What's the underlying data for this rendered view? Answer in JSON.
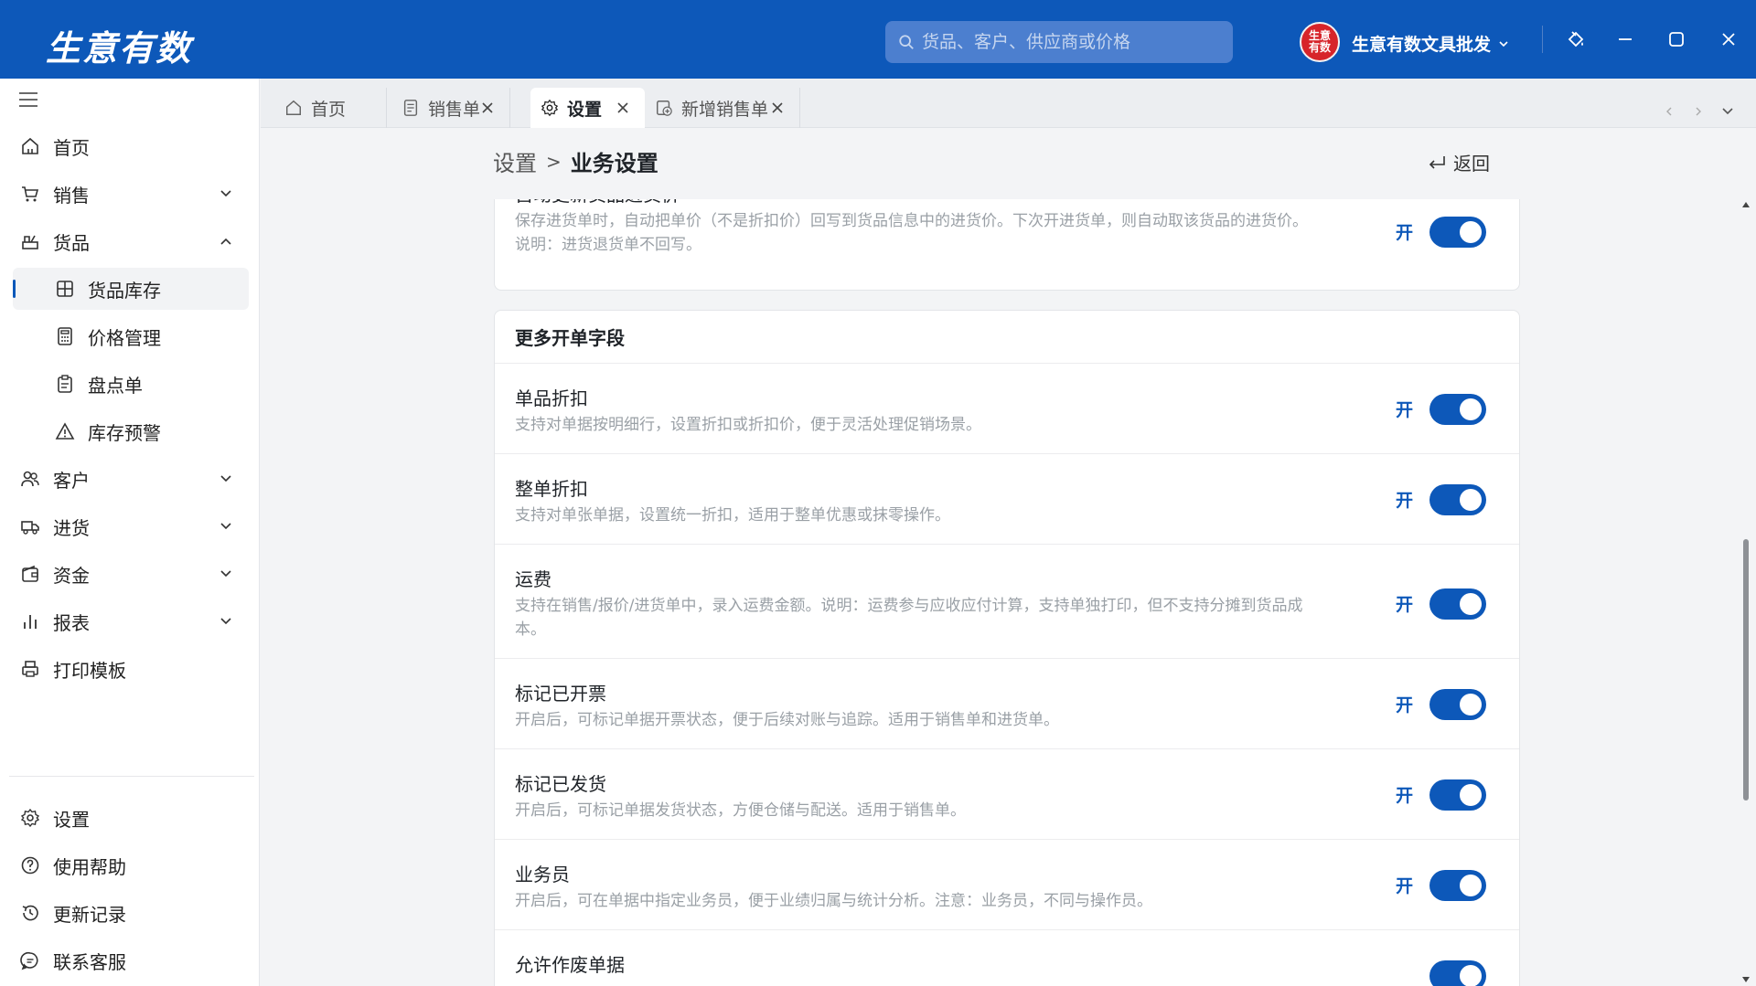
{
  "app": {
    "logo": "生意有数",
    "search_placeholder": "货品、客户、供应商或价格",
    "avatar_text": "生意有数",
    "shop_name": "生意有数文具批发"
  },
  "sidebar": {
    "items": [
      {
        "label": "首页"
      },
      {
        "label": "销售"
      },
      {
        "label": "货品"
      },
      {
        "label": "货品库存"
      },
      {
        "label": "价格管理"
      },
      {
        "label": "盘点单"
      },
      {
        "label": "库存预警"
      },
      {
        "label": "客户"
      },
      {
        "label": "进货"
      },
      {
        "label": "资金"
      },
      {
        "label": "报表"
      },
      {
        "label": "打印模板"
      }
    ],
    "bottom": [
      {
        "label": "设置"
      },
      {
        "label": "使用帮助"
      },
      {
        "label": "更新记录"
      },
      {
        "label": "联系客服"
      }
    ]
  },
  "tabs": [
    {
      "label": "首页"
    },
    {
      "label": "销售单"
    },
    {
      "label": "设置"
    },
    {
      "label": "新增销售单"
    }
  ],
  "breadcrumb": {
    "parent": "设置",
    "sep": ">",
    "current": "业务设置"
  },
  "back_label": "返回",
  "on_label": "开",
  "top_setting": {
    "title": "自动更新货品进货价",
    "desc": "保存进货单时，自动把单价（不是折扣价）回写到货品信息中的进货价。下次开进货单，则自动取该货品的进货价。说明：进货退货单不回写。"
  },
  "section": {
    "title": "更多开单字段",
    "rows": [
      {
        "title": "单品折扣",
        "desc": "支持对单据按明细行，设置折扣或折扣价，便于灵活处理促销场景。"
      },
      {
        "title": "整单折扣",
        "desc": "支持对单张单据，设置统一折扣，适用于整单优惠或抹零操作。"
      },
      {
        "title": "运费",
        "desc": "支持在销售/报价/进货单中，录入运费金额。说明：运费参与应收应付计算，支持单独打印，但不支持分摊到货品成本。"
      },
      {
        "title": "标记已开票",
        "desc": "开启后，可标记单据开票状态，便于后续对账与追踪。适用于销售单和进货单。"
      },
      {
        "title": "标记已发货",
        "desc": "开启后，可标记单据发货状态，方便仓储与配送。适用于销售单。"
      },
      {
        "title": "业务员",
        "desc": "开启后，可在单据中指定业务员，便于业绩归属与统计分析。注意：业务员，不同与操作员。"
      },
      {
        "title": "允许作废单据",
        "desc": ""
      }
    ]
  }
}
